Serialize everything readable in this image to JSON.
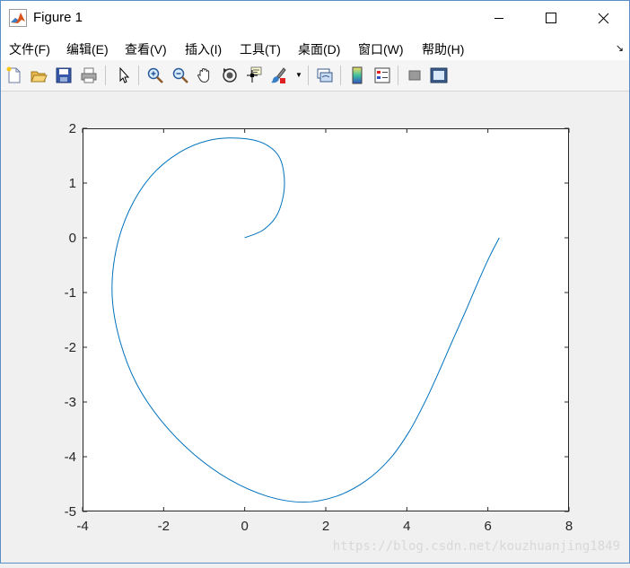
{
  "window": {
    "title": "Figure 1",
    "icon": "matlab-logo-icon"
  },
  "menu": {
    "items": [
      "文件(F)",
      "编辑(E)",
      "查看(V)",
      "插入(I)",
      "工具(T)",
      "桌面(D)",
      "窗口(W)",
      "帮助(H)"
    ]
  },
  "toolbar": {
    "buttons": [
      "new-figure-icon",
      "open-file-icon",
      "save-figure-icon",
      "print-figure-icon",
      "edit-plot-icon",
      "zoom-in-icon",
      "zoom-out-icon",
      "pan-icon",
      "rotate-3d-icon",
      "data-cursor-icon",
      "brush-icon",
      "link-plot-icon",
      "insert-colorbar-icon",
      "insert-legend-icon",
      "hide-plot-tools-icon",
      "show-plot-tools-icon"
    ]
  },
  "chart_data": {
    "type": "line",
    "series_color": "#0072bd",
    "xlim": [
      -4,
      8
    ],
    "ylim": [
      -5,
      2
    ],
    "xticks": [
      -4,
      -2,
      0,
      2,
      4,
      6,
      8
    ],
    "yticks": [
      -5,
      -4,
      -3,
      -2,
      -1,
      0,
      1,
      2
    ],
    "grid": false,
    "x": [
      0,
      0.47,
      0.82,
      0.98,
      0.87,
      0.48,
      -0.13,
      -0.88,
      -1.63,
      -2.32,
      -2.85,
      -3.18,
      -3.27,
      -3.09,
      -2.68,
      -2.05,
      -1.26,
      -0.37,
      0.55,
      1.45,
      2.27,
      2.99,
      3.58,
      4.05,
      4.44,
      4.79,
      5.12,
      5.45,
      5.75,
      6.03,
      6.28
    ],
    "y": [
      0,
      0.15,
      0.45,
      0.95,
      1.45,
      1.72,
      1.82,
      1.78,
      1.55,
      1.12,
      0.5,
      -0.25,
      -1.05,
      -1.85,
      -2.65,
      -3.35,
      -3.95,
      -4.42,
      -4.72,
      -4.83,
      -4.72,
      -4.44,
      -4.04,
      -3.55,
      -3.01,
      -2.45,
      -1.89,
      -1.34,
      -0.82,
      -0.36,
      0
    ],
    "watermark": "https://blog.csdn.net/kouzhuanjing1849"
  }
}
